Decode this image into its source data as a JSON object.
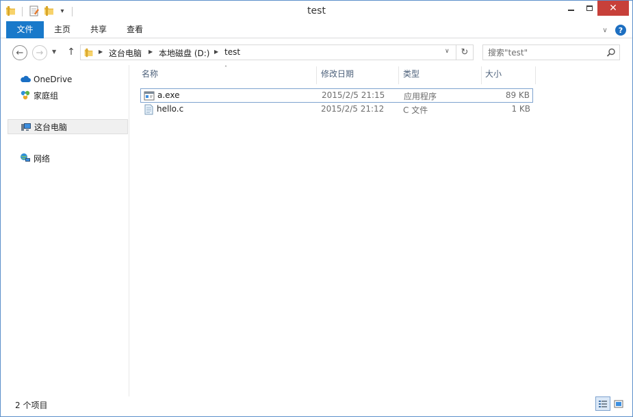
{
  "window": {
    "title": "test"
  },
  "quick_access": {
    "dropdown_glyph": "▾"
  },
  "window_controls": {
    "close_glyph": "✕"
  },
  "ribbon": {
    "tabs": [
      {
        "label": "文件"
      },
      {
        "label": "主页"
      },
      {
        "label": "共享"
      },
      {
        "label": "查看"
      }
    ],
    "expand_glyph": "∨",
    "help_glyph": "?"
  },
  "navigation": {
    "back_glyph": "←",
    "forward_glyph": "→",
    "recent_glyph": "▼",
    "up_glyph": "↑",
    "refresh_glyph": "↻",
    "dropdown_glyph": "∨",
    "breadcrumb": [
      {
        "label": "这台电脑"
      },
      {
        "label": "本地磁盘 (D:)"
      },
      {
        "label": "test"
      }
    ],
    "breadcrumb_separator": "▶"
  },
  "search": {
    "placeholder": "搜索\"test\"",
    "value": ""
  },
  "sidebar": {
    "items": [
      {
        "label": "OneDrive",
        "icon": "onedrive-icon"
      },
      {
        "label": "家庭组",
        "icon": "homegroup-icon"
      },
      {
        "label": "这台电脑",
        "icon": "computer-icon",
        "selected": true
      },
      {
        "label": "网络",
        "icon": "network-icon"
      }
    ]
  },
  "file_list": {
    "sort_indicator": "˄",
    "columns": [
      {
        "label": "名称"
      },
      {
        "label": "修改日期"
      },
      {
        "label": "类型"
      },
      {
        "label": "大小"
      }
    ],
    "rows": [
      {
        "name": "a.exe",
        "modified": "2015/2/5 21:15",
        "type": "应用程序",
        "size": "89 KB",
        "icon": "exe-file-icon",
        "selected": true
      },
      {
        "name": "hello.c",
        "modified": "2015/2/5 21:12",
        "type": "C 文件",
        "size": "1 KB",
        "icon": "text-file-icon",
        "selected": false
      }
    ]
  },
  "status_bar": {
    "item_count": "2 个项目"
  },
  "colors": {
    "accent": "#1979ca",
    "close_button": "#c7403a",
    "selection_border": "#7da2ce",
    "column_header_text": "#4c607a"
  }
}
